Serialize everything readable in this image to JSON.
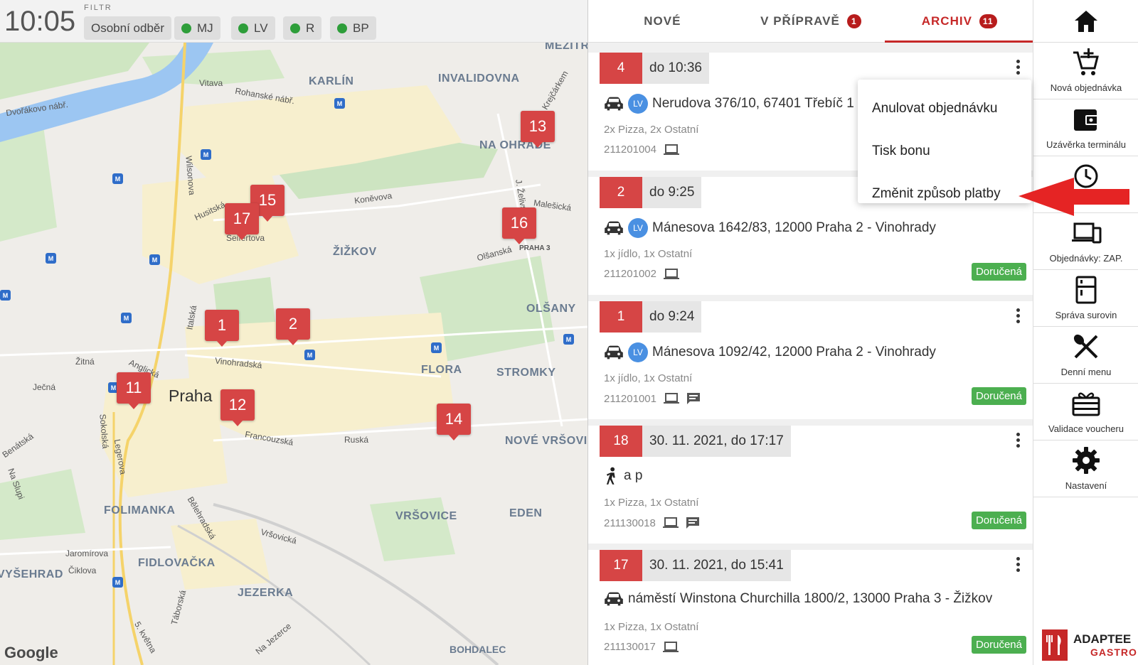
{
  "header": {
    "time": "10:05",
    "filter_label": "FILTR",
    "chips": [
      {
        "label": "Osobní odběr",
        "dot": false
      },
      {
        "label": "MJ",
        "dot": true
      },
      {
        "label": "LV",
        "dot": true
      },
      {
        "label": "R",
        "dot": true
      },
      {
        "label": "BP",
        "dot": true
      }
    ]
  },
  "map": {
    "city_label": "Praha",
    "attribution": "Google",
    "districts": [
      "KARLÍN",
      "INVALIDOVNA",
      "NA OHRADĚ",
      "ŽIŽKOV",
      "OLŠANY",
      "FLORA",
      "STROMKY",
      "NOVÉ VRŠOVICE",
      "FOLIMANKA",
      "VRŠOVICE",
      "EDEN",
      "FIDLOVAČKA",
      "JEZERKA",
      "VYŠEHRAD",
      "MEZITRATÍ"
    ],
    "streets": [
      "Vitava",
      "Rohanské nábř.",
      "Dvořákovo nábř.",
      "Husitská",
      "Koněvova",
      "Malešická",
      "Olšanská",
      "PRAHA 3",
      "Vinohradská",
      "Žitná",
      "Anglická",
      "Ječná",
      "Sokolská",
      "Legerova",
      "Francouzská",
      "Ruská",
      "Italská",
      "Wilsonova",
      "Seifertova",
      "Bělehradská",
      "Vršovická",
      "Jaromírova",
      "Čiklova",
      "Táborská",
      "Na Jezerce",
      "5. května",
      "Benátská",
      "Na Slupi",
      "J. Želivského",
      "Krejčárkem",
      "BOHDALEC"
    ],
    "pins": [
      "13",
      "15",
      "17",
      "16",
      "1",
      "2",
      "11",
      "12",
      "14"
    ]
  },
  "tabs": [
    {
      "label": "NOVÉ",
      "badge": ""
    },
    {
      "label": "V PŘÍPRAVĚ",
      "badge": "1"
    },
    {
      "label": "ARCHIV",
      "badge": "11"
    }
  ],
  "orders": [
    {
      "num": "4",
      "time": "do 10:36",
      "mode": "car",
      "lv": "LV",
      "address": "Nerudova 376/10, 67401 Třebíč 1",
      "items": "2x Pizza, 2x Ostatní",
      "code": "211201004",
      "status": ""
    },
    {
      "num": "2",
      "time": "do 9:25",
      "mode": "car",
      "lv": "LV",
      "address": "Mánesova 1642/83, 12000 Praha 2 - Vinohrady",
      "items": "1x jídlo, 1x Ostatní",
      "code": "211201002",
      "status": "Doručená"
    },
    {
      "num": "1",
      "time": "do 9:24",
      "mode": "car",
      "lv": "LV",
      "address": "Mánesova 1092/42, 12000 Praha 2 - Vinohrady",
      "items": "1x jídlo, 1x Ostatní",
      "code": "211201001",
      "status": "Doručená"
    },
    {
      "num": "18",
      "time": "30. 11. 2021, do 17:17",
      "mode": "walk",
      "lv": "",
      "address": "a p",
      "items": "1x Pizza, 1x Ostatní",
      "code": "211130018",
      "status": "Doručená"
    },
    {
      "num": "17",
      "time": "30. 11. 2021, do 15:41",
      "mode": "car",
      "lv": "",
      "address": "náměstí Winstona Churchilla 1800/2, 13000 Praha 3 - Žižkov",
      "items": "1x Pizza, 1x Ostatní",
      "code": "211130017",
      "status": "Doručená"
    }
  ],
  "context_menu": {
    "items": [
      "Anulovat objednávku",
      "Tisk bonu",
      "Změnit způsob platby"
    ]
  },
  "sidebar": {
    "items": [
      {
        "label": "",
        "icon": "home-icon"
      },
      {
        "label": "Nová objednávka",
        "icon": "cart-add-icon"
      },
      {
        "label": "Uzávěrka terminálu",
        "icon": "wallet-icon"
      },
      {
        "label": "",
        "icon": "clock-icon"
      },
      {
        "label": "Objednávky: ZAP.",
        "icon": "devices-icon"
      },
      {
        "label": "Správa surovin",
        "icon": "fridge-icon"
      },
      {
        "label": "Denní menu",
        "icon": "cutlery-icon"
      },
      {
        "label": "Validace voucheru",
        "icon": "gift-card-icon"
      },
      {
        "label": "Nastavení",
        "icon": "gear-icon"
      }
    ],
    "logo_line1": "ADAPTEE",
    "logo_line2": "GASTRO"
  },
  "colors": {
    "accent": "#c62828",
    "pin": "#d64545",
    "status_ok": "#4caf50",
    "lv_badge": "#4a90e2"
  }
}
